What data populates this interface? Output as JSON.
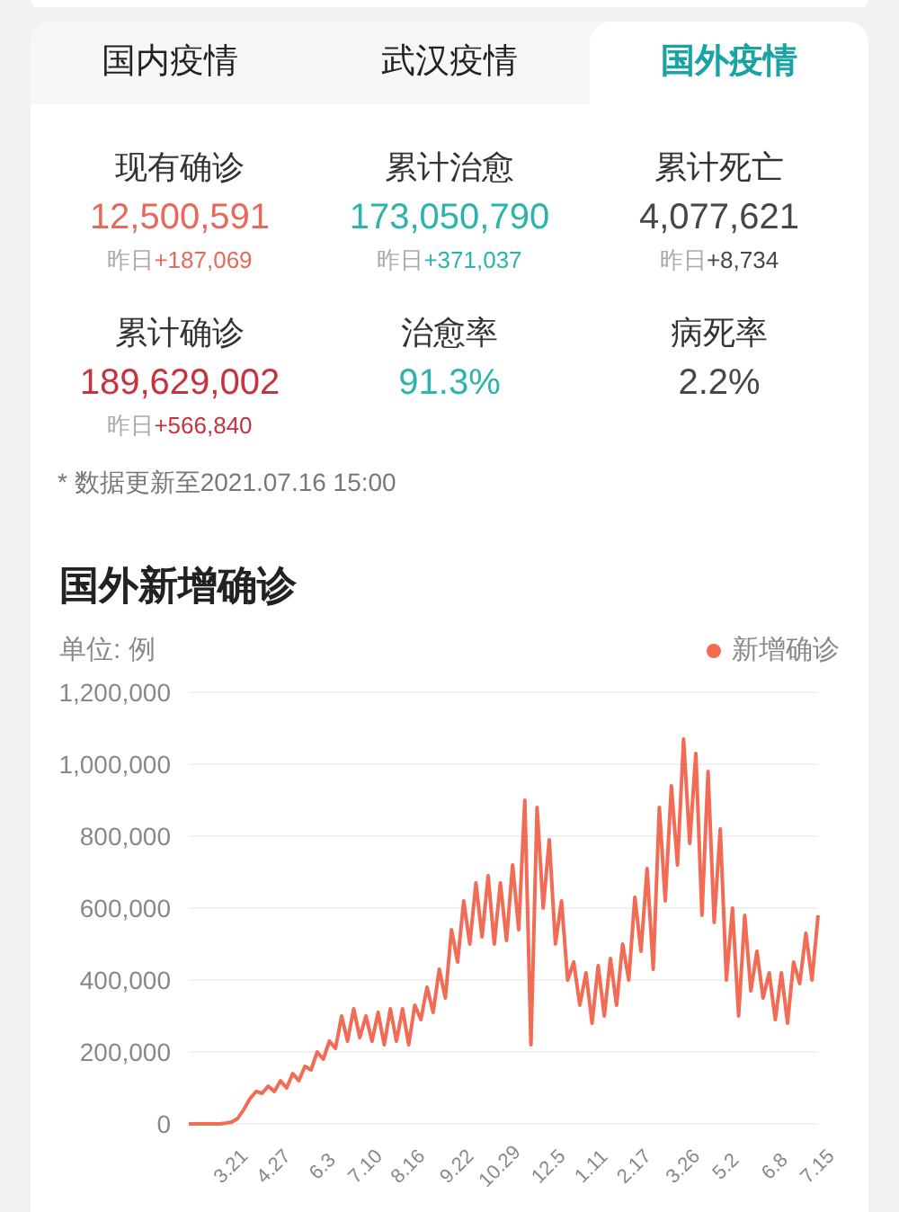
{
  "tabs": [
    {
      "label": "国内疫情",
      "selected": false
    },
    {
      "label": "武汉疫情",
      "selected": false
    },
    {
      "label": "国外疫情",
      "selected": true
    }
  ],
  "stats": [
    {
      "label": "现有确诊",
      "value": "12,500,591",
      "delta_label": "昨日",
      "delta": "+187,069",
      "color": "#e8685a"
    },
    {
      "label": "累计治愈",
      "value": "173,050,790",
      "delta_label": "昨日",
      "delta": "+371,037",
      "color": "#2bb3ad"
    },
    {
      "label": "累计死亡",
      "value": "4,077,621",
      "delta_label": "昨日",
      "delta": "+8,734",
      "color": "#474747"
    },
    {
      "label": "累计确诊",
      "value": "189,629,002",
      "delta_label": "昨日",
      "delta": "+566,840",
      "color": "#c7323f"
    },
    {
      "label": "治愈率",
      "value": "91.3%",
      "color": "#2bb3ad"
    },
    {
      "label": "病死率",
      "value": "2.2%",
      "color": "#474747"
    }
  ],
  "update_note": "* 数据更新至2021.07.16 15:00",
  "chart_section": {
    "title": "国外新增确诊",
    "unit": "单位: 例",
    "chart_data": {
      "type": "line",
      "ylim": [
        0,
        1200000
      ],
      "yticks": [
        {
          "value": 0,
          "label": "0"
        },
        {
          "value": 200000,
          "label": "200,000"
        },
        {
          "value": 400000,
          "label": "400,000"
        },
        {
          "value": 600000,
          "label": "600,000"
        },
        {
          "value": 800000,
          "label": "800,000"
        },
        {
          "value": 1000000,
          "label": "1,000,000"
        },
        {
          "value": 1200000,
          "label": "1,200,000"
        }
      ],
      "grid": true,
      "categories": [
        null,
        null,
        null,
        null,
        null,
        null,
        null,
        "3.21",
        null,
        null,
        null,
        null,
        null,
        null,
        "4.27",
        null,
        null,
        null,
        null,
        null,
        null,
        null,
        "6.3",
        null,
        null,
        null,
        null,
        null,
        null,
        "7.10",
        null,
        null,
        null,
        null,
        null,
        null,
        "8.16",
        null,
        null,
        null,
        null,
        null,
        null,
        null,
        "9.22",
        null,
        null,
        null,
        null,
        null,
        null,
        "10.29",
        null,
        null,
        null,
        null,
        null,
        null,
        null,
        "12.5",
        null,
        null,
        null,
        null,
        null,
        null,
        "1.11",
        null,
        null,
        null,
        null,
        null,
        null,
        "2.17",
        null,
        null,
        null,
        null,
        null,
        null,
        null,
        "3.26",
        null,
        null,
        null,
        null,
        null,
        null,
        "5.2",
        null,
        null,
        null,
        null,
        null,
        null,
        null,
        "6.8",
        null,
        null,
        null,
        null,
        null,
        null,
        "7.15"
      ],
      "series": [
        {
          "name": "新增确诊",
          "color": "#f26b55",
          "values": [
            0,
            0,
            0,
            0,
            0,
            0,
            2000,
            5000,
            15000,
            40000,
            70000,
            90000,
            85000,
            105000,
            90000,
            120000,
            100000,
            140000,
            120000,
            160000,
            150000,
            200000,
            180000,
            230000,
            210000,
            300000,
            230000,
            320000,
            240000,
            300000,
            230000,
            310000,
            220000,
            320000,
            230000,
            320000,
            220000,
            330000,
            290000,
            380000,
            310000,
            430000,
            350000,
            540000,
            450000,
            620000,
            500000,
            670000,
            520000,
            690000,
            500000,
            670000,
            510000,
            720000,
            540000,
            900000,
            220000,
            880000,
            600000,
            790000,
            500000,
            620000,
            400000,
            450000,
            330000,
            420000,
            280000,
            440000,
            300000,
            460000,
            330000,
            500000,
            400000,
            630000,
            480000,
            710000,
            430000,
            880000,
            620000,
            940000,
            720000,
            1070000,
            780000,
            1030000,
            580000,
            980000,
            560000,
            820000,
            400000,
            600000,
            300000,
            580000,
            370000,
            480000,
            350000,
            420000,
            290000,
            420000,
            280000,
            450000,
            390000,
            530000,
            400000,
            580000
          ]
        }
      ]
    }
  }
}
